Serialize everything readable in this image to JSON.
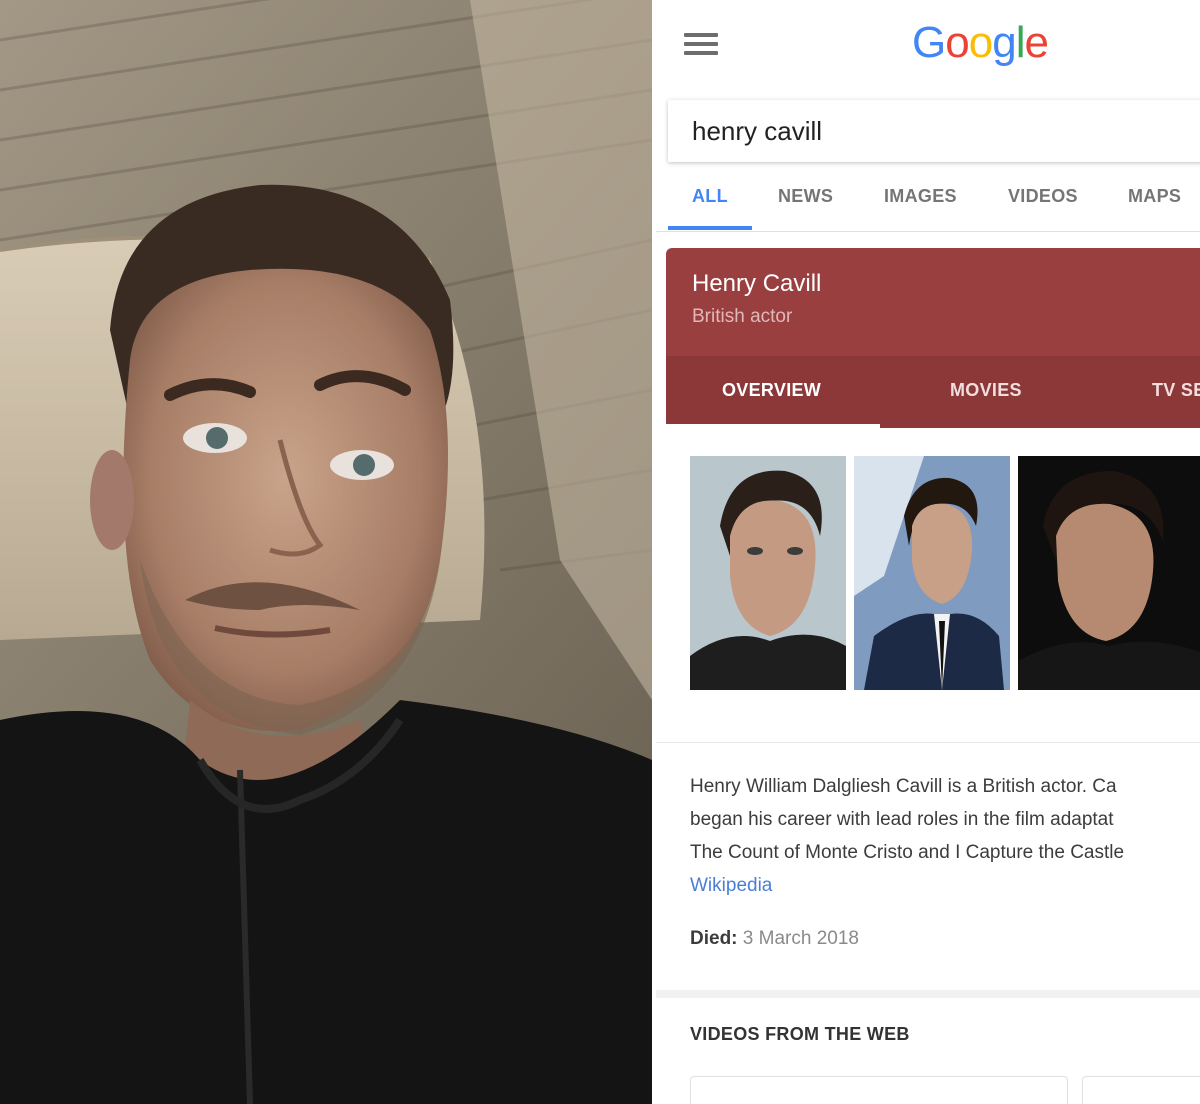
{
  "photo": {
    "icon": "selfie-photo"
  },
  "google": {
    "logo": {
      "letters": [
        "G",
        "o",
        "o",
        "g",
        "l",
        "e"
      ]
    },
    "search": {
      "value": "henry cavill"
    },
    "tabs": [
      {
        "label": "ALL",
        "active": true
      },
      {
        "label": "NEWS",
        "active": false
      },
      {
        "label": "IMAGES",
        "active": false
      },
      {
        "label": "VIDEOS",
        "active": false
      },
      {
        "label": "MAPS",
        "active": false
      }
    ],
    "knowledge_panel": {
      "title": "Henry Cavill",
      "subtitle": "British actor",
      "color": "#9a3f3f",
      "tabs": [
        {
          "label": "OVERVIEW",
          "active": true
        },
        {
          "label": "MOVIES",
          "active": false
        },
        {
          "label": "TV SE",
          "active": false
        }
      ]
    },
    "description": {
      "lines": [
        "Henry William Dalgliesh Cavill is a British actor. Ca",
        "began his career with lead roles in the film adaptat",
        "The Count of Monte Cristo and I Capture the Castle"
      ],
      "source_link": "Wikipedia"
    },
    "died": {
      "label": "Died:",
      "value": "3 March 2018"
    },
    "videos_heading": "VIDEOS FROM THE WEB"
  },
  "colors": {
    "accent": "#4285f4",
    "panel": "#9a3f3f"
  }
}
